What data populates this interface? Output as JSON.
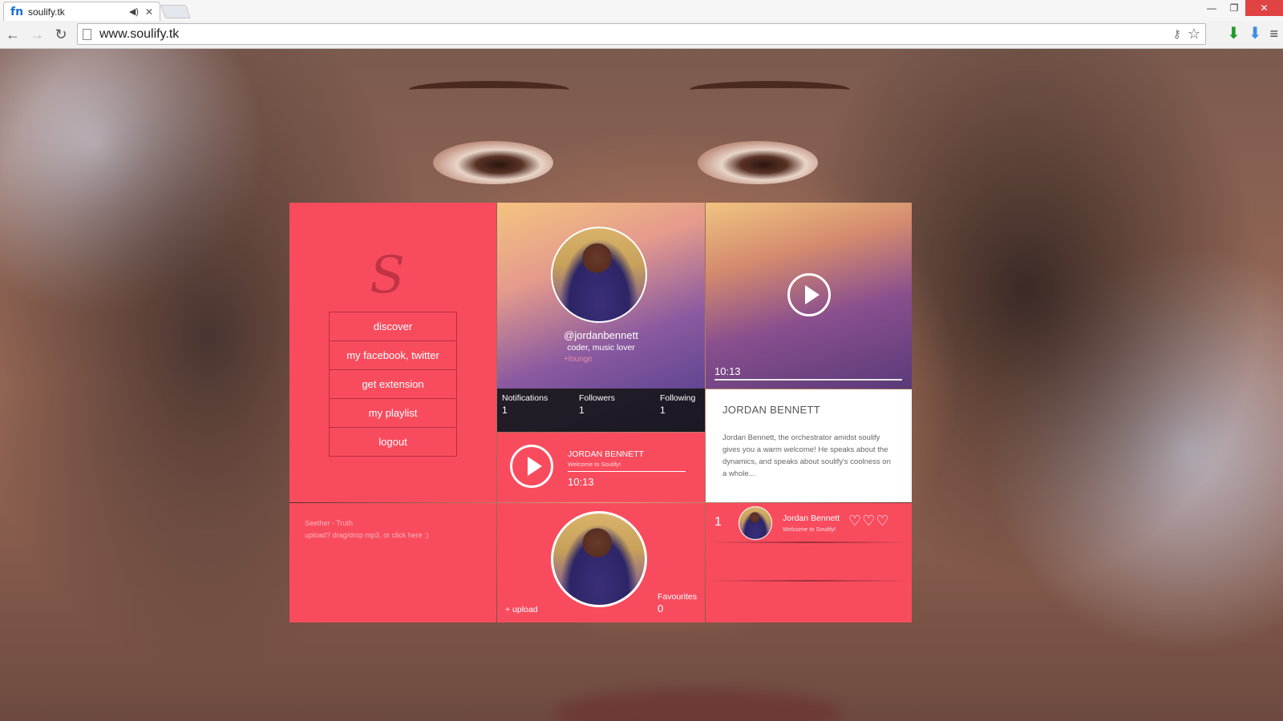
{
  "browser": {
    "tab_title": "soulify.tk",
    "favicon_text": "fn",
    "audio_icon": "speaker-icon",
    "url": "www.soulify.tk"
  },
  "menu": {
    "logo": "S",
    "items": [
      "discover",
      "my facebook, twitter",
      "get extension",
      "my playlist",
      "logout"
    ]
  },
  "profile": {
    "handle": "@jordanbennett",
    "bio": "coder, music lover",
    "lounge": "+lounge",
    "stats": [
      {
        "label": "Notifications",
        "value": "1"
      },
      {
        "label": "Followers",
        "value": "1"
      },
      {
        "label": "Following",
        "value": "1"
      }
    ]
  },
  "video": {
    "time": "10:13"
  },
  "description": {
    "title": "JORDAN BENNETT",
    "body": "Jordan Bennett, the orchestrator amidst soulify gives you a warm welcome! He speaks about the dynamics, and speaks about soulify's coolness on a whole..."
  },
  "player": {
    "artist": "JORDAN BENNETT",
    "subtitle": "Welcome to Soulify!",
    "time": "10:13"
  },
  "upload": {
    "track": "Seether - Truth",
    "hint": "upload? drag/drop mp3, or click here :)"
  },
  "favourites": {
    "upload_label": "+ upload",
    "label": "Favourites",
    "count": "0"
  },
  "list": {
    "rank": "1",
    "name": "Jordan Bennett",
    "subtitle": "Welcome to Soulify!"
  },
  "colors": {
    "accent": "#f84c5e",
    "dark_overlay": "#141414"
  }
}
